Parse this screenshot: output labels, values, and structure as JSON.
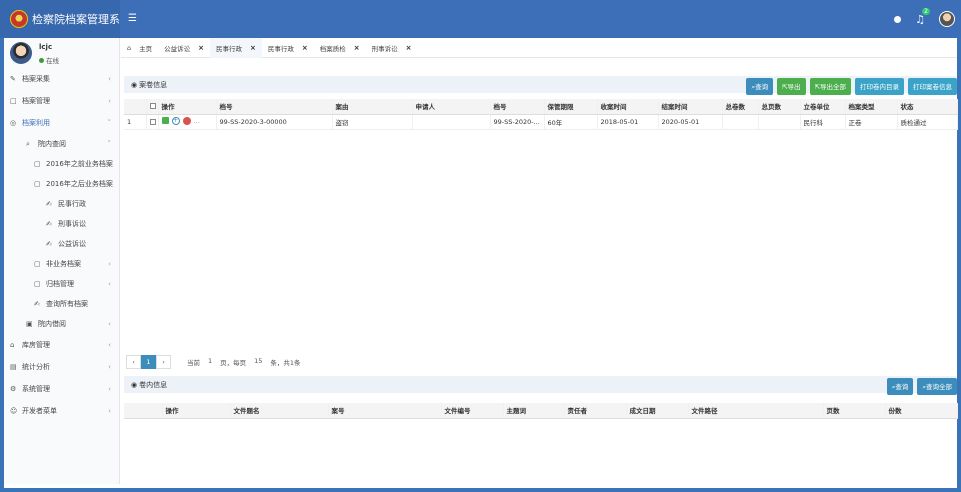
{
  "app": {
    "title": "检察院档案管理系"
  },
  "user": {
    "name": "lcjc",
    "status": "在线"
  },
  "sidebar": {
    "items": [
      {
        "label": "档案采集",
        "icon": "pencil-icon",
        "level": 0
      },
      {
        "label": "档案管理",
        "icon": "file-icon",
        "level": 0
      },
      {
        "label": "档案利用",
        "icon": "search-circle-icon",
        "level": 0,
        "active": true
      },
      {
        "label": "院内查阅",
        "icon": "search-icon",
        "level": 1
      },
      {
        "label": "2016年之前业务档案",
        "icon": "folder-icon",
        "level": 2
      },
      {
        "label": "2016年之后业务档案",
        "icon": "folder-icon",
        "level": 2
      },
      {
        "label": "民事行政",
        "icon": "edit-icon",
        "level": 3
      },
      {
        "label": "刑事诉讼",
        "icon": "edit-icon",
        "level": 3
      },
      {
        "label": "公益诉讼",
        "icon": "edit-icon",
        "level": 3
      },
      {
        "label": "非业务档案",
        "icon": "folder-icon",
        "level": 2
      },
      {
        "label": "归档管理",
        "icon": "folder-icon",
        "level": 2
      },
      {
        "label": "查询所有档案",
        "icon": "edit-icon",
        "level": 2
      },
      {
        "label": "院内借阅",
        "icon": "folder-open-icon",
        "level": 1
      },
      {
        "label": "库房管理",
        "icon": "home-icon",
        "level": 0
      },
      {
        "label": "统计分析",
        "icon": "chart-icon",
        "level": 0
      },
      {
        "label": "系统管理",
        "icon": "gear-icon",
        "level": 0
      },
      {
        "label": "开发者菜单",
        "icon": "user-icon",
        "level": 0
      }
    ]
  },
  "tabs": [
    {
      "label": "主页",
      "closable": false
    },
    {
      "label": "公益诉讼",
      "closable": true
    },
    {
      "label": "民事行政",
      "closable": true,
      "active": true
    },
    {
      "label": "民事行政",
      "closable": true
    },
    {
      "label": "档案质检",
      "closable": true
    },
    {
      "label": "刑事诉讼",
      "closable": true
    }
  ],
  "case_panel": {
    "title": "案卷信息",
    "buttons": [
      {
        "label": "查询",
        "style": "blue",
        "icon": "search-icon"
      },
      {
        "label": "导出",
        "style": "green",
        "icon": "export-icon"
      },
      {
        "label": "导出全部",
        "style": "green",
        "icon": "export-icon"
      },
      {
        "label": "打印卷内目录",
        "style": "teal"
      },
      {
        "label": "打印案卷信息",
        "style": "teal"
      }
    ],
    "columns": [
      "",
      "",
      "操作",
      "档号",
      "案由",
      "申请人",
      "档号",
      "保管期限",
      "收案时间",
      "结案时间",
      "总卷数",
      "总页数",
      "立卷单位",
      "档案类型",
      "状态"
    ],
    "rows": [
      [
        "1",
        "",
        "",
        "99-SS-2020-3-00000",
        "盗窃",
        "",
        "99-SS-2020-...",
        "60年",
        "2018-05-01",
        "2020-05-01",
        "",
        "",
        "民行科",
        "正卷",
        "质检通过"
      ]
    ]
  },
  "pager": {
    "prev": "‹",
    "current": "1",
    "next": "›",
    "info_parts": [
      "当前",
      "1",
      "页，每页",
      "15",
      "条，共1条"
    ]
  },
  "volume_panel": {
    "title": "卷内信息",
    "buttons": [
      {
        "label": "查询",
        "icon": "search-icon"
      },
      {
        "label": "查询全部",
        "icon": "search-icon"
      }
    ],
    "columns": [
      "",
      "操作",
      "文件题名",
      "案号",
      "文件编号",
      "主题词",
      "责任者",
      "成文日期",
      "文件路径",
      "页数",
      "份数"
    ]
  }
}
